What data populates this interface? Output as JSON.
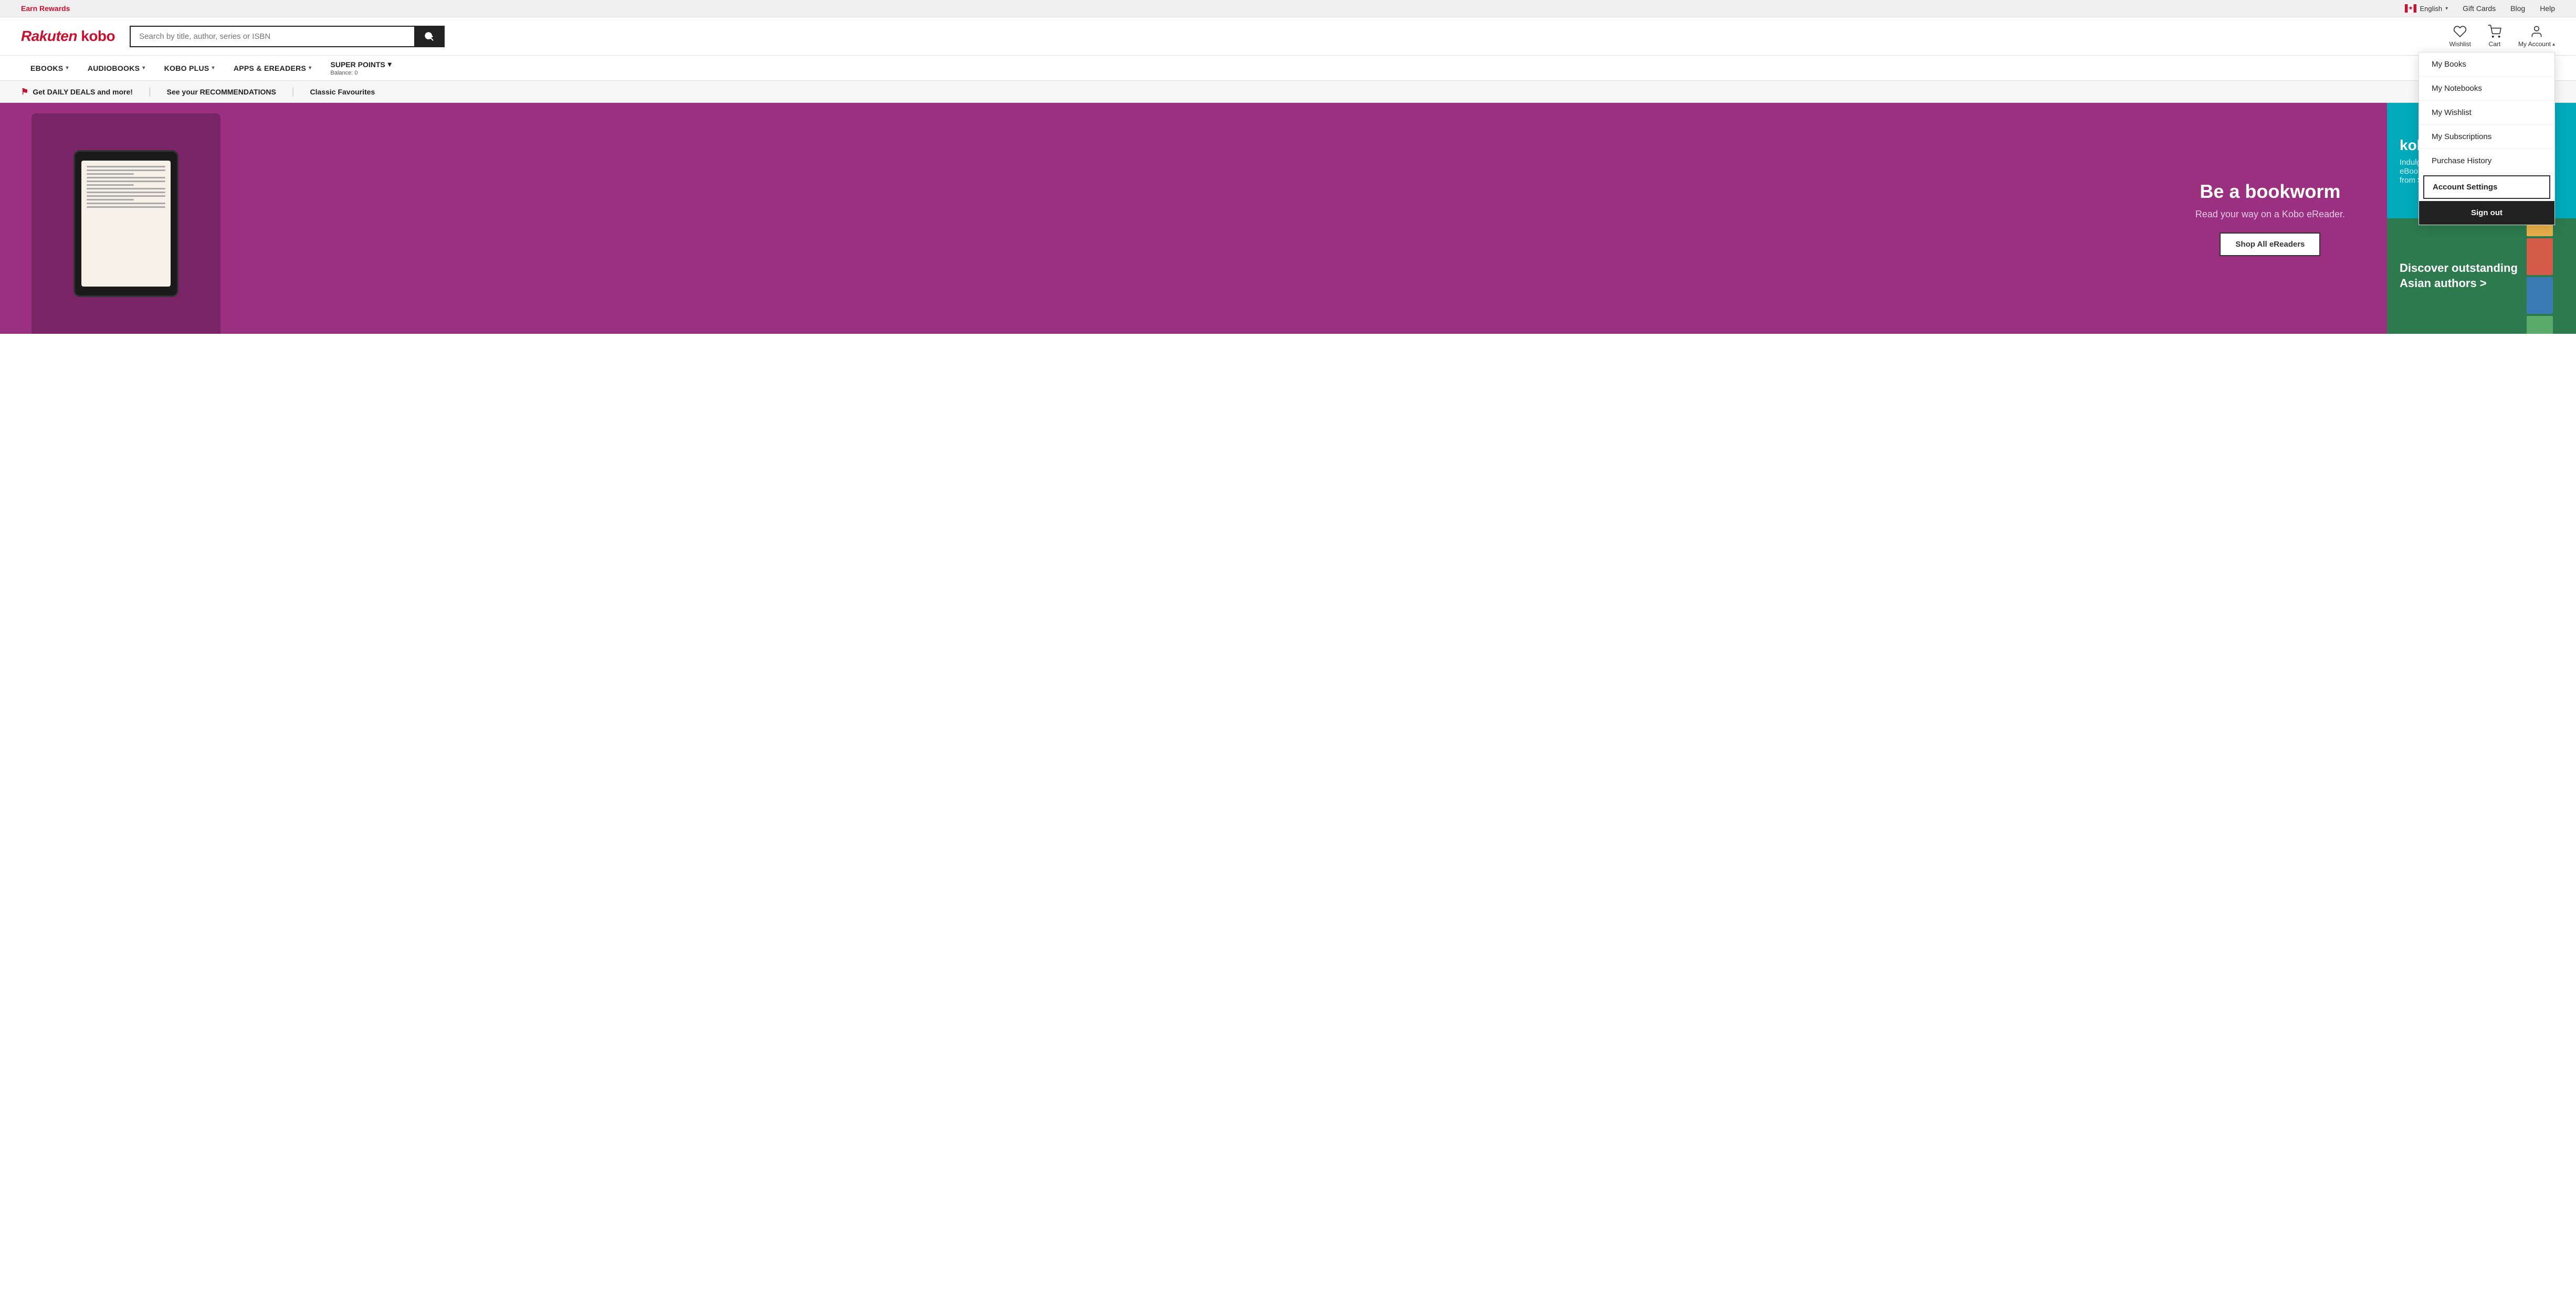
{
  "topbar": {
    "earn_rewards": "Earn Rewards",
    "lang": "English",
    "gift_cards": "Gift Cards",
    "blog": "Blog",
    "help": "Help"
  },
  "header": {
    "logo": "Rakuten kobo",
    "search_placeholder": "Search by title, author, series or ISBN",
    "wishlist_label": "Wishlist",
    "cart_label": "Cart",
    "account_label": "My Account"
  },
  "nav": {
    "items": [
      {
        "label": "eBooks",
        "has_chevron": true
      },
      {
        "label": "Audiobooks",
        "has_chevron": true
      },
      {
        "label": "Kobo Plus",
        "has_chevron": true
      },
      {
        "label": "Apps & eReaders",
        "has_chevron": true
      },
      {
        "label": "Super Points",
        "has_chevron": true,
        "balance": "Balance: 0"
      }
    ]
  },
  "promo_bar": {
    "items": [
      {
        "label": "Get DAILY DEALS and more!",
        "has_flag": true
      },
      {
        "label": "See your RECOMMENDATIONS"
      },
      {
        "label": "Classic Favourites"
      }
    ]
  },
  "hero": {
    "title": "Be a bookworm",
    "subtitle": "Read your way on a Kobo eReader.",
    "button_label": "Shop All eReaders",
    "side_top_title": "kobo p",
    "side_top_sub": "Indulge\neBooks\nfrom $9",
    "side_bottom_title": "Discover outstanding Asian authors >"
  },
  "account_dropdown": {
    "items": [
      {
        "label": "My Books",
        "key": "my-books"
      },
      {
        "label": "My Notebooks",
        "key": "my-notebooks"
      },
      {
        "label": "My Wishlist",
        "key": "my-wishlist"
      },
      {
        "label": "My Subscriptions",
        "key": "my-subscriptions"
      },
      {
        "label": "Purchase History",
        "key": "purchase-history"
      }
    ],
    "account_settings_label": "Account Settings",
    "sign_out_label": "Sign out"
  },
  "colors": {
    "brand_red": "#c8102e",
    "hero_purple": "#9b3080",
    "hero_teal": "#00aabb",
    "hero_green": "#2d7a4f",
    "dark": "#222",
    "light_gray": "#f0f0f0"
  }
}
